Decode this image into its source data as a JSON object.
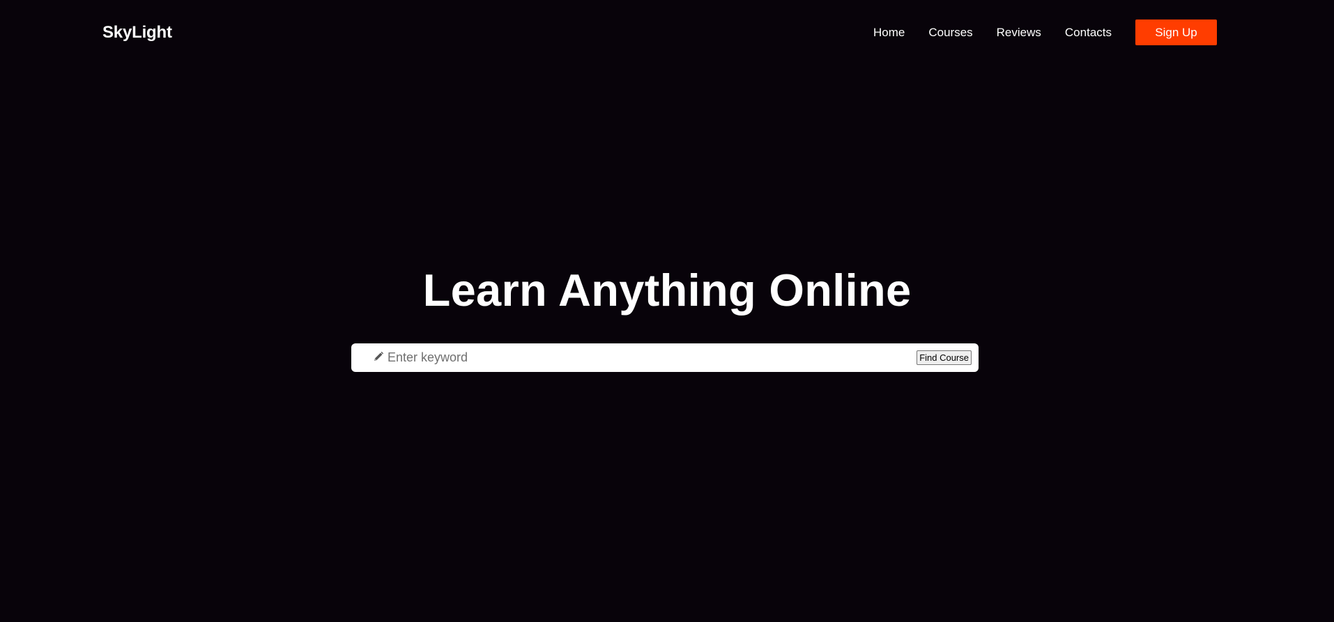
{
  "header": {
    "logo": "SkyLight",
    "nav": [
      "Home",
      "Courses",
      "Reviews",
      "Contacts"
    ],
    "signup_label": "Sign Up"
  },
  "hero": {
    "title": "Learn Anything Online",
    "search": {
      "icon": "pencil-icon",
      "placeholder": "Enter keyword",
      "value": "",
      "button_label": "Find Course"
    }
  },
  "colors": {
    "background": "#08030a",
    "accent": "#ff3d00",
    "text": "#ffffff"
  }
}
